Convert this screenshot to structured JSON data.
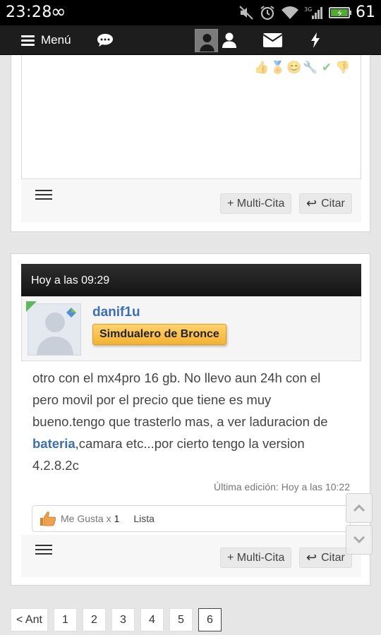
{
  "status_bar": {
    "time": "23:28",
    "battery_percent": "61",
    "icons": [
      "infinity-icon",
      "mute-icon",
      "alarm-icon",
      "wifi-icon",
      "signal-icon",
      "battery-icon"
    ]
  },
  "navbar": {
    "menu_label": "Menú",
    "icons": [
      "hamburger-icon",
      "chat-icon",
      "avatar",
      "user-icon",
      "envelope-icon",
      "lightning-icon"
    ]
  },
  "post1": {
    "multiquote_label": "+ Multi-Cita",
    "quote_label": "Citar"
  },
  "post2": {
    "timestamp": "Hoy a las 09:29",
    "username": "danif1u",
    "user_title": "Simdualero de Bronce",
    "message_lines": {
      "line1": "otro con el mx4pro 16 gb. No llevo aun 24h con el",
      "line2": "pero movil por el precio que tiene es muy",
      "line3": "bueno.tengo que trasterlo mas, a ver laduracion de",
      "line4_link": "bateria",
      "line4_rest": ",camara etc...por cierto tengo la version",
      "line5": "4.2.8.2c"
    },
    "edited": "Última edición: Hoy a las 10:22",
    "likes": {
      "label": "Me Gusta x",
      "count": "1",
      "list_label": "Lista"
    },
    "multiquote_label": "+ Multi-Cita",
    "quote_label": "Citar"
  },
  "pagination": {
    "prev": "< Ant",
    "pages": [
      "1",
      "2",
      "3",
      "4",
      "5",
      "6"
    ],
    "current": "6"
  },
  "colors": {
    "accent_link": "#3b6fb6",
    "badge_gold": "#f4b232",
    "header_dark": "#1d1d1d"
  }
}
